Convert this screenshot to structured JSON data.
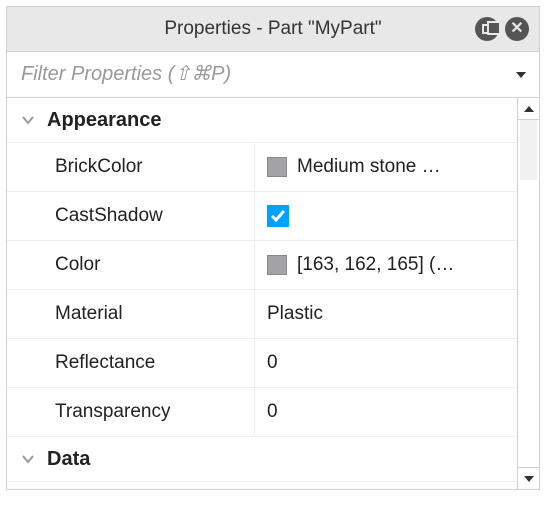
{
  "titlebar": {
    "title": "Properties - Part \"MyPart\""
  },
  "filter": {
    "placeholder": "Filter Properties (⇧⌘P)"
  },
  "sections": {
    "appearance": {
      "title": "Appearance",
      "rows": {
        "brickcolor": {
          "name": "BrickColor",
          "value": "Medium stone …",
          "swatch": "#a3a2a5"
        },
        "castshadow": {
          "name": "CastShadow",
          "checked": true
        },
        "color": {
          "name": "Color",
          "value": "[163, 162, 165] (…",
          "swatch": "#a3a2a5"
        },
        "material": {
          "name": "Material",
          "value": "Plastic"
        },
        "reflectance": {
          "name": "Reflectance",
          "value": "0"
        },
        "transparency": {
          "name": "Transparency",
          "value": "0"
        }
      }
    },
    "data": {
      "title": "Data"
    }
  }
}
